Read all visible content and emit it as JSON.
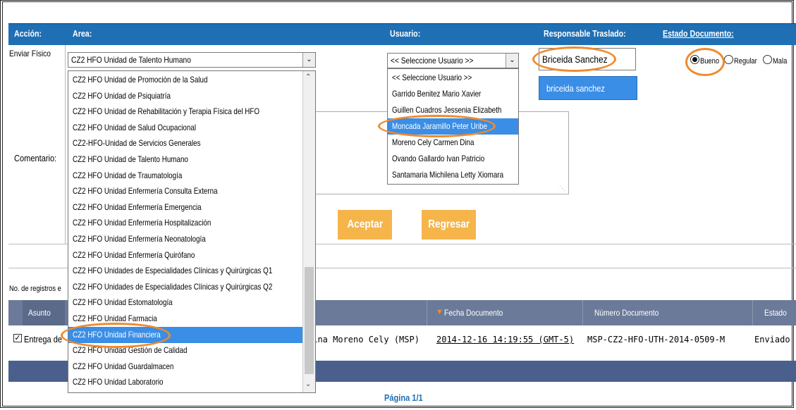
{
  "header": {
    "accion": "Acción:",
    "area": "Area:",
    "usuario": "Usuario:",
    "responsable": "Responsable Traslado:",
    "estado": "Estado Documento:"
  },
  "row": {
    "accion_value": "Enviar Físico",
    "area_selected": "CZ2 HFO Unidad de Talento Humano",
    "usuario_selected": "<< Seleccione Usuario >>",
    "responsable_value": "Briceida Sanchez",
    "autocomplete": "briceida sanchez",
    "radios": [
      "Bueno",
      "Regular",
      "Mala"
    ]
  },
  "area_options": [
    "CZ2 HFO Unidad de Promoción de la Salud",
    "CZ2 HFO Unidad de Psiquiatría",
    "CZ2 HFO Unidad de Rehabilitación y Terapia Física del HFO",
    "CZ2 HFO Unidad de Salud Ocupacional",
    "CZ2-HFO-Unidad de Servicios Generales",
    "CZ2 HFO Unidad de Talento Humano",
    "CZ2 HFO Unidad de Traumatología",
    "CZ2 HFO Unidad Enfermería Consulta Externa",
    "CZ2 HFO Unidad Enfermería Emergencia",
    "CZ2 HFO Unidad Enfermería Hospitalización",
    "CZ2 HFO Unidad Enfermería Neonatología",
    "CZ2 HFO Unidad Enfermería Quirófano",
    "CZ2 HFO Unidades de Especialidades Clínicas y Quirúrgicas Q1",
    "CZ2 HFO Unidades de Especialidades Clínicas y Quirúrgicas Q2",
    "CZ2 HFO Unidad Estomatología",
    "CZ2 HFO Unidad Farmacia",
    "CZ2 HFO Unidad Financiera",
    "CZ2 HFO Unidad Gestión de Calidad",
    "CZ2 HFO Unidad Guardalmacen",
    "CZ2 HFO Unidad Laboratorio"
  ],
  "user_options": [
    "<< Seleccione Usuario >>",
    "Garrido Benitez Mario Xavier",
    "Guillen Cuadros Jessenia Elizabeth",
    "Moncada Jaramillo Peter Uribe",
    "Moreno Cely Carmen Dina",
    "Ovando Gallardo Ivan Patricio",
    "Santamaria Michilena Letty Xiomara"
  ],
  "form": {
    "comentario": "Comentario:",
    "aceptar": "Aceptar",
    "regresar": "Regresar"
  },
  "table": {
    "registros": "No. de registros e",
    "col_asunto": "Asunto",
    "col_fecha": "Fecha Documento",
    "col_numero": "Número Documento",
    "col_estado": "Estado",
    "row_asunto": "Entrega de",
    "row_remitente": "Dina Moreno Cely (MSP)",
    "row_fecha": "2014-12-16 14:19:55 (GMT-5)",
    "row_numero": "MSP-CZ2-HFO-UTH-2014-0509-M",
    "row_estado": "Enviado",
    "pagina": "Página 1/1"
  },
  "colors": {
    "header_blue": "#1f6fb4",
    "highlight": "#3a8ee6",
    "annotation_orange": "#f08a2c",
    "button_orange": "#f5b54a",
    "grid_header": "#6b7a99"
  }
}
